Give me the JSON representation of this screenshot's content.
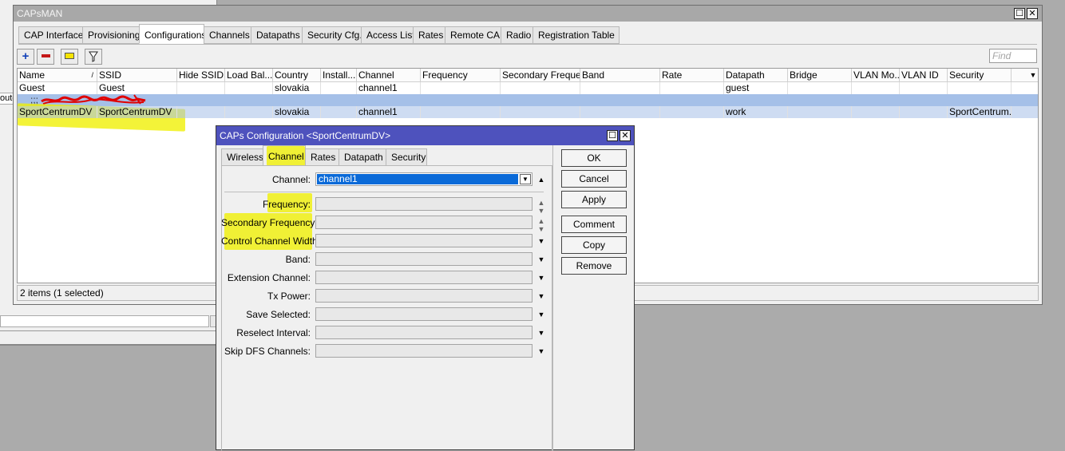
{
  "background_window": {
    "left_text": "oute"
  },
  "capsman": {
    "title": "CAPsMAN",
    "tabs": [
      "CAP Interface",
      "Provisioning",
      "Configurations",
      "Channels",
      "Datapaths",
      "Security Cfg.",
      "Access List",
      "Rates",
      "Remote CAP",
      "Radio",
      "Registration Table"
    ],
    "active_tab": "Configurations",
    "toolbar": {
      "add_icon": "plus-icon",
      "remove_icon": "minus-icon",
      "comment_icon": "note-icon",
      "filter_icon": "funnel-icon"
    },
    "find_placeholder": "Find",
    "columns": [
      "Name",
      "SSID",
      "Hide SSID",
      "Load Bal...",
      "Country",
      "Install...",
      "Channel",
      "Frequency",
      "Secondary Freque...",
      "Band",
      "Rate",
      "Datapath",
      "Bridge",
      "VLAN Mo...",
      "VLAN ID",
      "Security"
    ],
    "rows": [
      {
        "name": "Guest",
        "ssid": "Guest",
        "country": "slovakia",
        "channel": "channel1",
        "datapath": "guest",
        "security": ""
      },
      {
        "comment": ";;; ",
        "comment_redacted": "redacted comment"
      },
      {
        "name": "SportCentrumDV",
        "ssid": "SportCentrumDV",
        "country": "slovakia",
        "channel": "channel1",
        "datapath": "work",
        "security": "SportCentrum..."
      }
    ],
    "status": "2 items (1 selected)"
  },
  "dialog": {
    "title": "CAPs Configuration <SportCentrumDV>",
    "tabs": [
      "Wireless",
      "Channel",
      "Rates",
      "Datapath",
      "Security"
    ],
    "active_tab": "Channel",
    "channel_label": "Channel:",
    "channel_value": "channel1",
    "fields": [
      {
        "label": "Frequency:",
        "control": "updown"
      },
      {
        "label": "Secondary Frequency:",
        "control": "updown"
      },
      {
        "label": "Control Channel Width:",
        "control": "dropdown"
      },
      {
        "label": "Band:",
        "control": "dropdown"
      },
      {
        "label": "Extension Channel:",
        "control": "dropdown"
      },
      {
        "label": "Tx Power:",
        "control": "dropdown"
      },
      {
        "label": "Save Selected:",
        "control": "dropdown"
      },
      {
        "label": "Reselect Interval:",
        "control": "dropdown"
      },
      {
        "label": "Skip DFS Channels:",
        "control": "dropdown"
      }
    ],
    "buttons": [
      "OK",
      "Cancel",
      "Apply",
      "Comment",
      "Copy",
      "Remove"
    ]
  },
  "colors": {
    "dialog_title": "#4e52bd",
    "selection": "#a5c0e8",
    "highlight": "#f0f000",
    "input_selection": "#0a6ad8"
  }
}
